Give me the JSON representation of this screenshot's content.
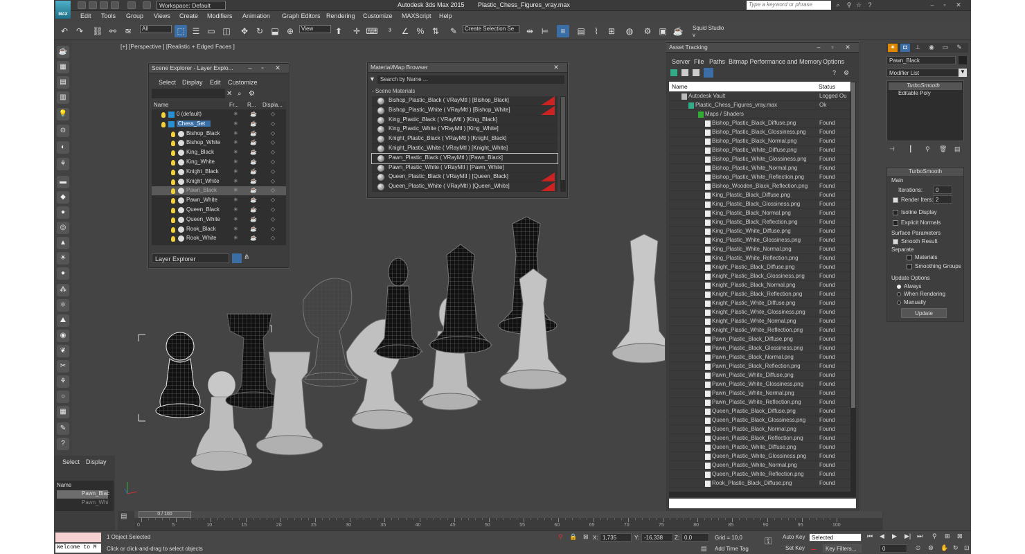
{
  "app": {
    "logo": "MAX",
    "workspace": "Workspace: Default",
    "title": "Autodesk 3ds Max 2015",
    "file": "Plastic_Chess_Figures_vray.max",
    "search_placeholder": "Type a keyword or phrase"
  },
  "menu": [
    "Edit",
    "Tools",
    "Group",
    "Views",
    "Create",
    "Modifiers",
    "Animation",
    "Graph Editors",
    "Rendering",
    "Customize",
    "MAXScript",
    "Help"
  ],
  "toolbar": {
    "filter": "All",
    "view": "View",
    "selection_set": "Create Selection Se",
    "squid": "Squid Studio v"
  },
  "viewport": {
    "label": "[+] [Perspective ] [Realistic + Edged Faces ]"
  },
  "scene_explorer": {
    "title": "Scene Explorer - Layer Explo...",
    "menu": [
      "Select",
      "Display",
      "Edit",
      "Customize"
    ],
    "headers": [
      "Name",
      "Fr...",
      "R...",
      "Displa..."
    ],
    "rows": [
      {
        "name": "0 (default)",
        "level": 0,
        "layer": true
      },
      {
        "name": "Chess_Set",
        "level": 0,
        "layer": true,
        "selected": true
      },
      {
        "name": "Bishop_Black",
        "level": 1
      },
      {
        "name": "Bishop_White",
        "level": 1
      },
      {
        "name": "King_Black",
        "level": 1
      },
      {
        "name": "King_White",
        "level": 1
      },
      {
        "name": "Knight_Black",
        "level": 1
      },
      {
        "name": "Knight_White",
        "level": 1
      },
      {
        "name": "Pawn_Black",
        "level": 1,
        "highlight": true
      },
      {
        "name": "Pawn_White",
        "level": 1
      },
      {
        "name": "Queen_Black",
        "level": 1
      },
      {
        "name": "Queen_White",
        "level": 1
      },
      {
        "name": "Rook_Black",
        "level": 1
      },
      {
        "name": "Rook_White",
        "level": 1
      }
    ],
    "footer": "Layer Explorer"
  },
  "material_browser": {
    "title": "Material/Map Browser",
    "search": "Search by Name ...",
    "section": "- Scene Materials",
    "items": [
      "Bishop_Plastic_Black ( VRayMtl ) [Bishop_Black]",
      "Bishop_Plastic_White ( VRayMtl ) [Bishop_White]",
      "King_Plastic_Black ( VRayMtl ) [King_Black]",
      "King_Plastic_White ( VRayMtl ) [King_White]",
      "Knight_Plastic_Black ( VRayMtl ) [Knight_Black]",
      "Knight_Plastic_White ( VRayMtl ) [Knight_White]",
      "Pawn_Plastic_Black ( VRayMtl ) [Pawn_Black]",
      "Pawn_Plastic_White ( VRayMtl ) [Pawn_White]",
      "Queen_Plastic_Black ( VRayMtl ) [Queen_Black]",
      "Queen_Plastic_White ( VRayMtl ) [Queen_White]"
    ],
    "selected_index": 6
  },
  "asset_tracking": {
    "title": "Asset Tracking",
    "menu": [
      "Server",
      "File",
      "Paths",
      "Bitmap Performance and Memory",
      "Options"
    ],
    "headers": [
      "Name",
      "Status"
    ],
    "top": [
      {
        "name": "Autodesk Vault",
        "status": "Logged Ou"
      },
      {
        "name": "Plastic_Chess_Figures_vray.max",
        "status": "Ok"
      },
      {
        "name": "Maps / Shaders",
        "status": ""
      }
    ],
    "files": [
      "Bishop_Plastic_Black_Diffuse.png",
      "Bishop_Plastic_Black_Glossiness.png",
      "Bishop_Plastic_Black_Normal.png",
      "Bishop_Plastic_White_Diffuse.png",
      "Bishop_Plastic_White_Glossiness.png",
      "Bishop_Plastic_White_Normal.png",
      "Bishop_Plastic_White_Reflection.png",
      "Bishop_Wooden_Black_Reflection.png",
      "King_Plastic_Black_Diffuse.png",
      "King_Plastic_Black_Glossiness.png",
      "King_Plastic_Black_Normal.png",
      "King_Plastic_Black_Reflection.png",
      "King_Plastic_White_Diffuse.png",
      "King_Plastic_White_Glossiness.png",
      "King_Plastic_White_Normal.png",
      "King_Plastic_White_Reflection.png",
      "Knight_Plastic_Black_Diffuse.png",
      "Knight_Plastic_Black_Glossiness.png",
      "Knight_Plastic_Black_Normal.png",
      "Knight_Plastic_Black_Reflection.png",
      "Knight_Plastic_White_Diffuse.png",
      "Knight_Plastic_White_Glossiness.png",
      "Knight_Plastic_White_Normal.png",
      "Knight_Plastic_White_Reflection.png",
      "Pawn_Plastic_Black_Diffuse.png",
      "Pawn_Plastic_Black_Glossiness.png",
      "Pawn_Plastic_Black_Normal.png",
      "Pawn_Plastic_Black_Reflection.png",
      "Pawn_Plastic_White_Diffuse.png",
      "Pawn_Plastic_White_Glossiness.png",
      "Pawn_Plastic_White_Normal.png",
      "Pawn_Plastic_White_Reflection.png",
      "Queen_Plastic_Black_Diffuse.png",
      "Queen_Plastic_Black_Glossiness.png",
      "Queen_Plastic_Black_Normal.png",
      "Queen_Plastic_Black_Reflection.png",
      "Queen_Plastic_White_Diffuse.png",
      "Queen_Plastic_White_Glossiness.png",
      "Queen_Plastic_White_Normal.png",
      "Queen_Plastic_White_Reflection.png",
      "Rook_Plastic_Black_Diffuse.png"
    ],
    "file_status": "Found"
  },
  "command_panel": {
    "object_name": "Pawn_Black",
    "modifier_list": "Modifier List",
    "stack": [
      "TurboSmooth",
      "Editable Poly"
    ],
    "turbosmooth": {
      "title": "TurboSmooth",
      "main": "Main",
      "iterations_label": "Iterations:",
      "iterations": "0",
      "render_iters_label": "Render Iters:",
      "render_iters": "2",
      "isoline": "Isoline Display",
      "explicit": "Explicit Normals",
      "surface": "Surface Parameters",
      "smooth_result": "Smooth Result",
      "separate": "Separate",
      "materials": "Materials",
      "smoothing": "Smoothing Groups",
      "update_options": "Update Options",
      "always": "Always",
      "when_rendering": "When Rendering",
      "manually": "Manually",
      "update": "Update"
    }
  },
  "left_panel": {
    "tabs": [
      "Select",
      "Display"
    ],
    "header": "Name",
    "rows": [
      "Pawn_Blac",
      "Pawn_Whi"
    ]
  },
  "timeline": {
    "frame": "0 / 100",
    "ticks": [
      "0",
      "5",
      "10",
      "15",
      "20",
      "25",
      "30",
      "35",
      "40",
      "45",
      "50",
      "55",
      "60",
      "65",
      "70",
      "75",
      "80",
      "85",
      "90",
      "95",
      "100"
    ]
  },
  "status": {
    "maxscript": "Welcome to M",
    "selected": "1 Object Selected",
    "prompt": "Click or click-and-drag to select objects",
    "x_label": "X:",
    "x": "1,735",
    "y_label": "Y:",
    "y": "-16,338",
    "z_label": "Z:",
    "z": "0,0",
    "grid": "Grid = 10,0",
    "add_time_tag": "Add Time Tag",
    "auto_key": "Auto Key",
    "set_key": "Set Key",
    "selected_mode": "Selected",
    "key_filters": "Key Filters...",
    "frame": "0"
  }
}
